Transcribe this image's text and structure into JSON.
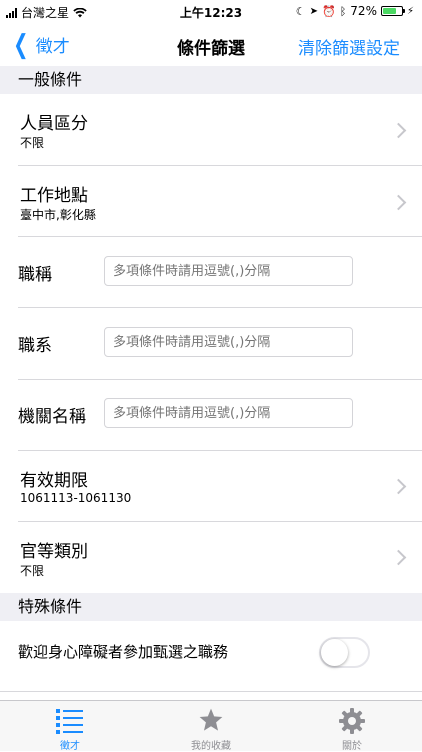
{
  "status_bar": {
    "carrier": "台灣之星",
    "time": "上午12:23",
    "battery": "72%"
  },
  "nav": {
    "back_label": "徵才",
    "title": "條件篩選",
    "right_label": "清除篩選設定"
  },
  "sections": {
    "general": "一般條件",
    "special": "特殊條件"
  },
  "rows": {
    "personnel": {
      "title": "人員區分",
      "value": "不限"
    },
    "location": {
      "title": "工作地點",
      "value": "臺中市,彰化縣"
    },
    "job_title": {
      "label": "職稱",
      "placeholder": "多項條件時請用逗號(,)分隔"
    },
    "job_series": {
      "label": "職系",
      "placeholder": "多項條件時請用逗號(,)分隔"
    },
    "agency": {
      "label": "機關名稱",
      "placeholder": "多項條件時請用逗號(,)分隔"
    },
    "validity": {
      "title": "有效期限",
      "value": "1061113-1061130"
    },
    "rank": {
      "title": "官等類別",
      "value": "不限"
    }
  },
  "special": {
    "disability_label": "歡迎身心障礙者參加甄選之職務",
    "disability_on": false
  },
  "tabs": [
    {
      "label": "徵才",
      "icon": "list-icon",
      "active": true
    },
    {
      "label": "我的收藏",
      "icon": "star-icon",
      "active": false
    },
    {
      "label": "關於",
      "icon": "gear-icon",
      "active": false
    }
  ],
  "colors": {
    "accent": "#1a8cff",
    "section_bg": "#efeff4",
    "inactive": "#8e8e93"
  }
}
